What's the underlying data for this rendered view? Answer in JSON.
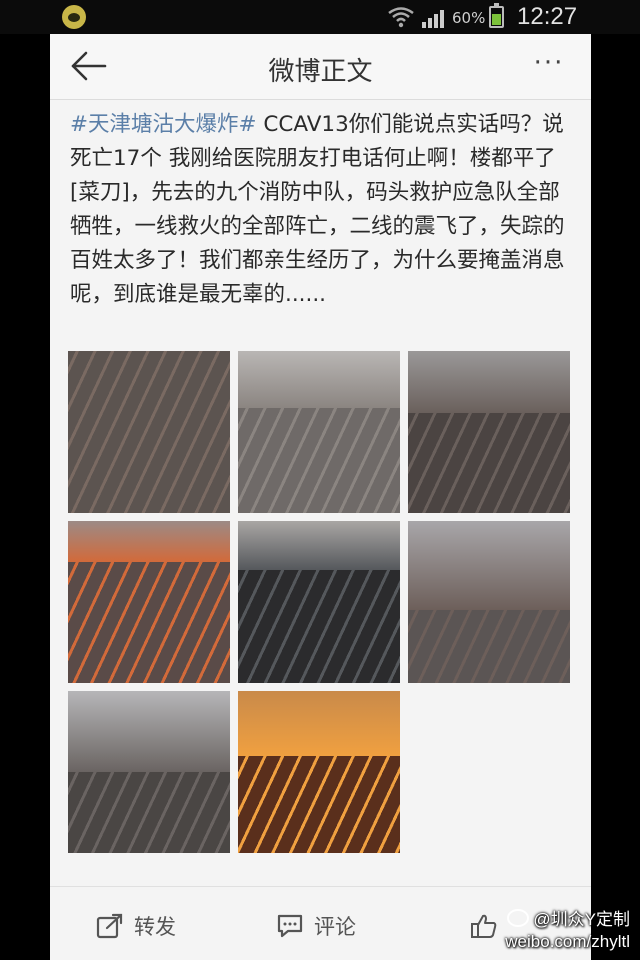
{
  "status_bar": {
    "battery": "60%",
    "time": "12:27",
    "icons": [
      "app-icon",
      "wifi-icon",
      "signal-icon",
      "battery-icon"
    ]
  },
  "nav": {
    "title": "微博正文",
    "back_icon": "back-arrow-icon",
    "more_label": "···"
  },
  "post": {
    "hashtag": "#天津塘沽大爆炸#",
    "text": " CCAV13你们能说点实话吗？说死亡17个 我刚给医院朋友打电话何止啊！楼都平了[菜刀]，先去的九个消防中队，码头救护应急队全部牺牲，一线救火的全部阵亡，二线的震飞了，失踪的百姓太多了！我们都亲生经历了，为什么要掩盖消息呢，到底谁是最无辜的......"
  },
  "photos": [
    {
      "sky": "#8a8a86",
      "ground": "#5c5450",
      "accent": "#7a6a62",
      "horizon": 0.0
    },
    {
      "sky": "#b9b6b4",
      "ground": "#6f6a68",
      "accent": "#8b8581",
      "horizon": 0.35
    },
    {
      "sky": "#9a9898",
      "ground": "#4b4442",
      "accent": "#6a605c",
      "horizon": 0.38
    },
    {
      "sky": "#9c8a86",
      "ground": "#5a4b48",
      "accent": "#d26a3a",
      "horizon": 0.25
    },
    {
      "sky": "#a9a6a4",
      "ground": "#2b2b2d",
      "accent": "#55585c",
      "horizon": 0.3
    },
    {
      "sky": "#a8a6a9",
      "ground": "#5b5554",
      "accent": "#6d5f5a",
      "horizon": 0.55
    },
    {
      "sky": "#b6b6b8",
      "ground": "#4a4644",
      "accent": "#6a6462",
      "horizon": 0.5
    },
    {
      "sky": "#c98a4a",
      "ground": "#5a2f1c",
      "accent": "#f0a040",
      "horizon": 0.4
    }
  ],
  "actions": {
    "repost": "转发",
    "comment": "评论",
    "like_icon": "thumbs-up-icon"
  },
  "watermark": {
    "name": "@圳众Y定制",
    "url": "weibo.com/zhyltl"
  }
}
